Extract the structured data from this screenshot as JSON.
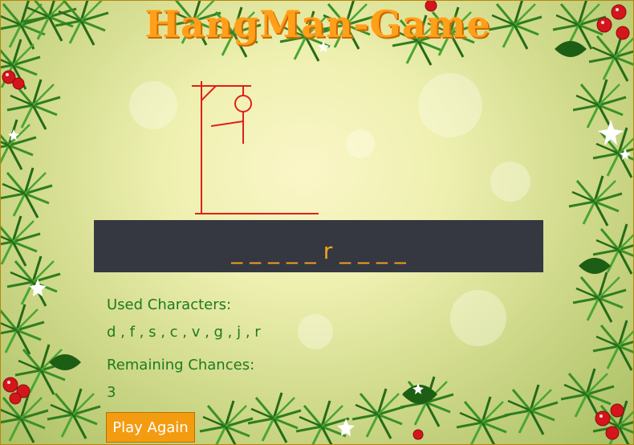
{
  "title": "HangMan-Game",
  "word_display": "_ _ _ _ _ r _ _ _ _",
  "used_characters": {
    "label": "Used Characters:",
    "value": "d , f , s , c , v , g , j , r"
  },
  "remaining_chances": {
    "label": "Remaining Chances:",
    "value": "3"
  },
  "play_again_label": "Play Again",
  "colors": {
    "title": "#ff9f1a",
    "word_bar": "#353841",
    "word_text": "#f2a51a",
    "label_text": "#1f7a1f",
    "button": "#f39c12",
    "gallows": "#e0201a"
  },
  "icons": {
    "background": "christmas-pine-garland",
    "gallows": "hangman-gallows-icon"
  }
}
